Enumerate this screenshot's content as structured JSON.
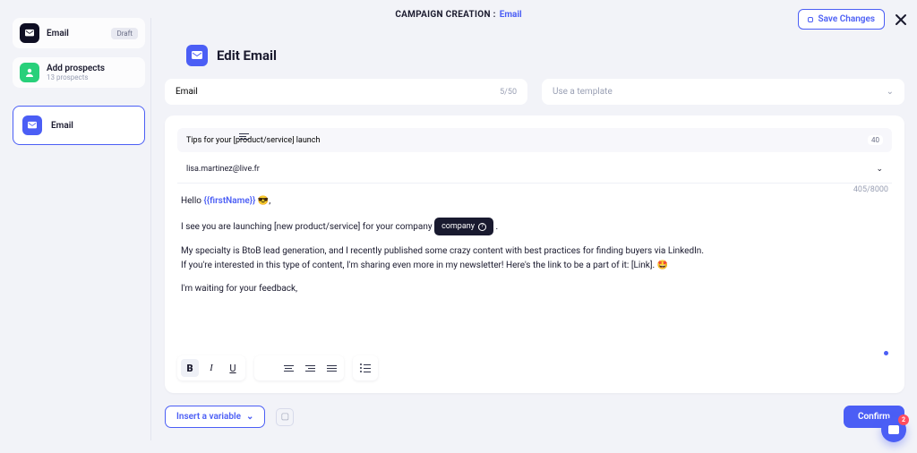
{
  "topbar": {
    "label": "CAMPAIGN CREATION :",
    "link": "Email",
    "save": "Save Changes"
  },
  "campaign": {
    "name": "Email",
    "status": "Draft"
  },
  "prospects": {
    "title": "Add prospects",
    "count": "13 prospects"
  },
  "step": {
    "label": "Email"
  },
  "heading": "Edit Email",
  "name_field": {
    "value": "Email",
    "counter": "5/50"
  },
  "template": {
    "placeholder": "Use a template"
  },
  "subject": {
    "value": "Tips for your [product/service] launch",
    "count": "40"
  },
  "sender": {
    "email": "lisa.martinez@live.fr"
  },
  "body": {
    "count": "405/8000",
    "greeting_pre": "Hello ",
    "greeting_var": "{{firstName}}",
    "greeting_post": " 😎,",
    "line2_pre": "I see you are launching [new product/service] for your company ",
    "tag": "company",
    "line2_post": " .",
    "line3": "My specialty is BtoB lead generation, and I recently published some crazy content with best practices for finding buyers via LinkedIn.",
    "line4": "If you're interested in this type of content, I'm sharing even more in my newsletter! Here's the link to be a part of it: [Link]. 🤩",
    "line5": "I'm waiting for your feedback,"
  },
  "footer": {
    "insert_var": "Insert a variable",
    "confirm": "Confirm"
  },
  "chat": {
    "count": "2"
  }
}
